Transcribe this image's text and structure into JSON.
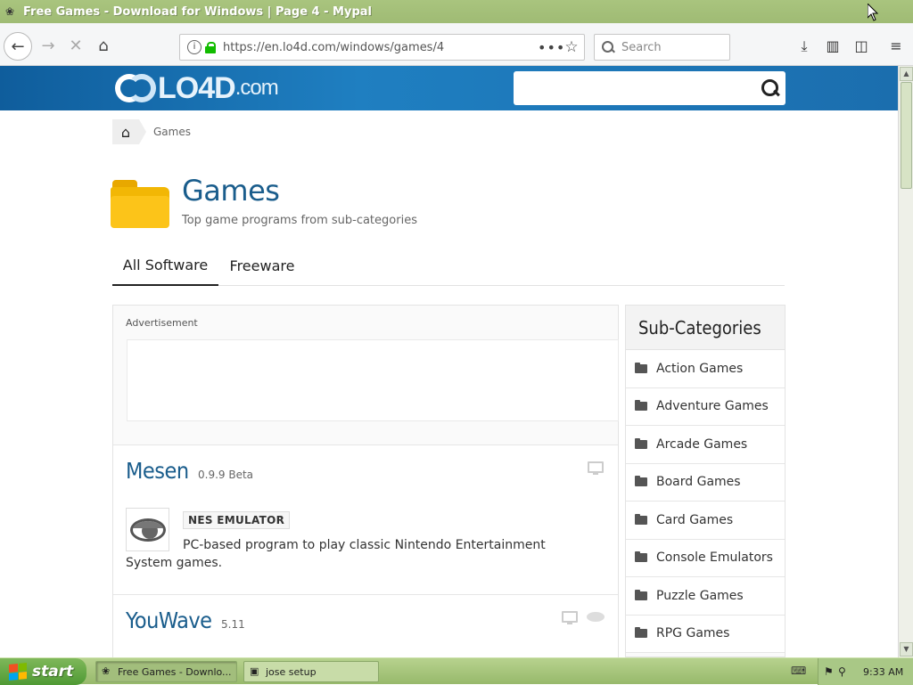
{
  "window": {
    "title": "Free Games - Download for Windows  |  Page 4 - Mypal"
  },
  "toolbar": {
    "url": "https://en.lo4d.com/windows/games/4",
    "search_placeholder": "Search",
    "page_actions": "•••"
  },
  "site": {
    "logo_main": "LO4D",
    "logo_domain": ".com",
    "search_value": ""
  },
  "breadcrumb": {
    "current": "Games"
  },
  "page": {
    "title": "Games",
    "subtitle": "Top game programs from sub-categories"
  },
  "tabs": [
    {
      "label": "All Software",
      "active": true
    },
    {
      "label": "Freeware",
      "active": false
    }
  ],
  "main": {
    "ad_label": "Advertisement",
    "entries": [
      {
        "name": "Mesen",
        "version": "0.9.9 Beta",
        "tag": "NES EMULATOR",
        "description": "PC-based program to play classic Nintendo Entertainment System games."
      },
      {
        "name": "YouWave",
        "version": "5.11"
      }
    ]
  },
  "sidebar": {
    "heading": "Sub-Categories",
    "items": [
      {
        "label": "Action Games"
      },
      {
        "label": "Adventure Games"
      },
      {
        "label": "Arcade Games"
      },
      {
        "label": "Board Games"
      },
      {
        "label": "Card Games"
      },
      {
        "label": "Console Emulators"
      },
      {
        "label": "Puzzle Games"
      },
      {
        "label": "RPG Games"
      }
    ]
  },
  "taskbar": {
    "start_label": "start",
    "tasks": [
      {
        "label": "Free Games - Downlo...",
        "active": true
      },
      {
        "label": "jose setup",
        "active": false
      }
    ],
    "clock": "9:33 AM"
  },
  "colors": {
    "header_blue": "#1f7fc1",
    "title_blue": "#1a5d8c",
    "folder_yellow": "#fcc419",
    "xp_green": "#9fbb74"
  }
}
